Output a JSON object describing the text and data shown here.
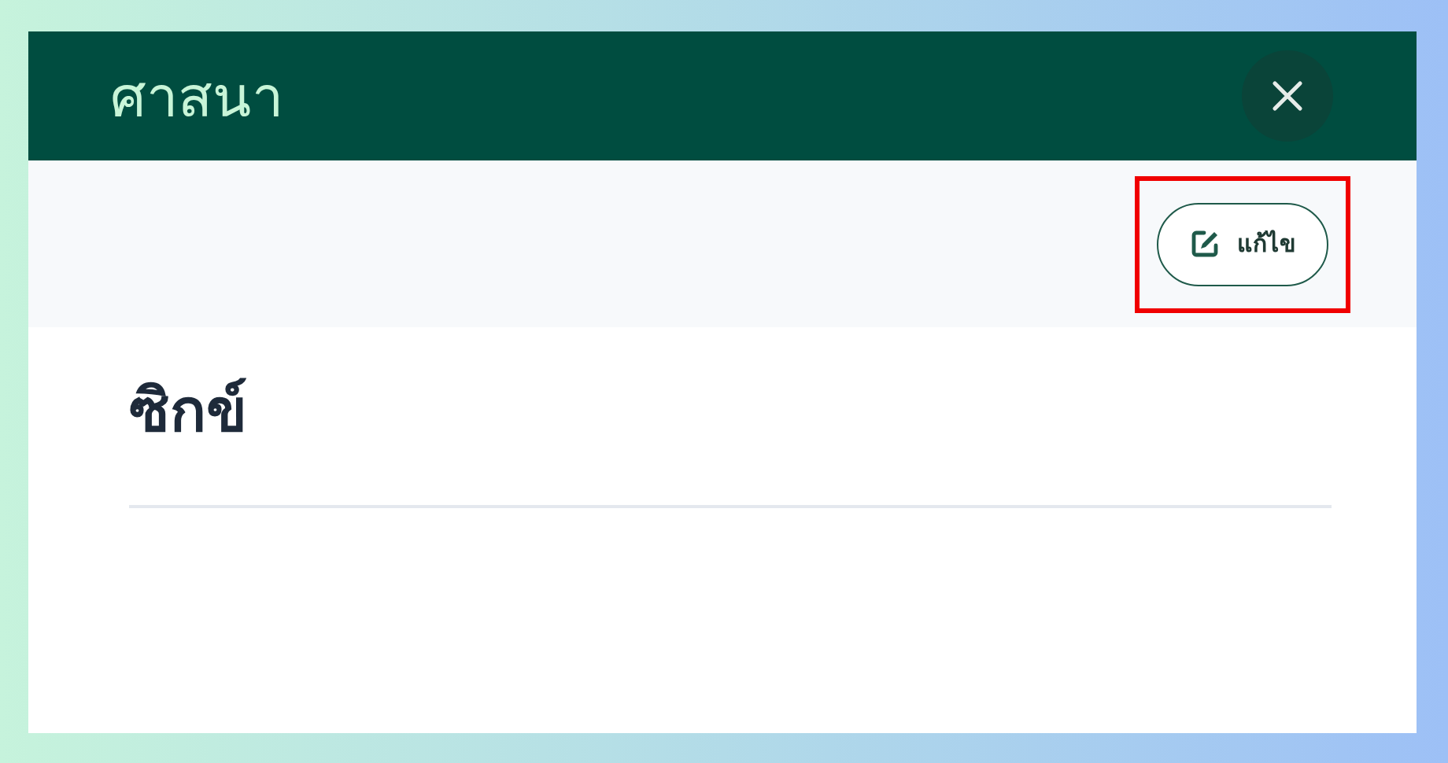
{
  "dialog": {
    "title": "ศาสนา"
  },
  "toolbar": {
    "edit_button": {
      "label": "แก้ไข",
      "highlighted": true
    }
  },
  "content": {
    "value": "ซิกข์"
  }
}
